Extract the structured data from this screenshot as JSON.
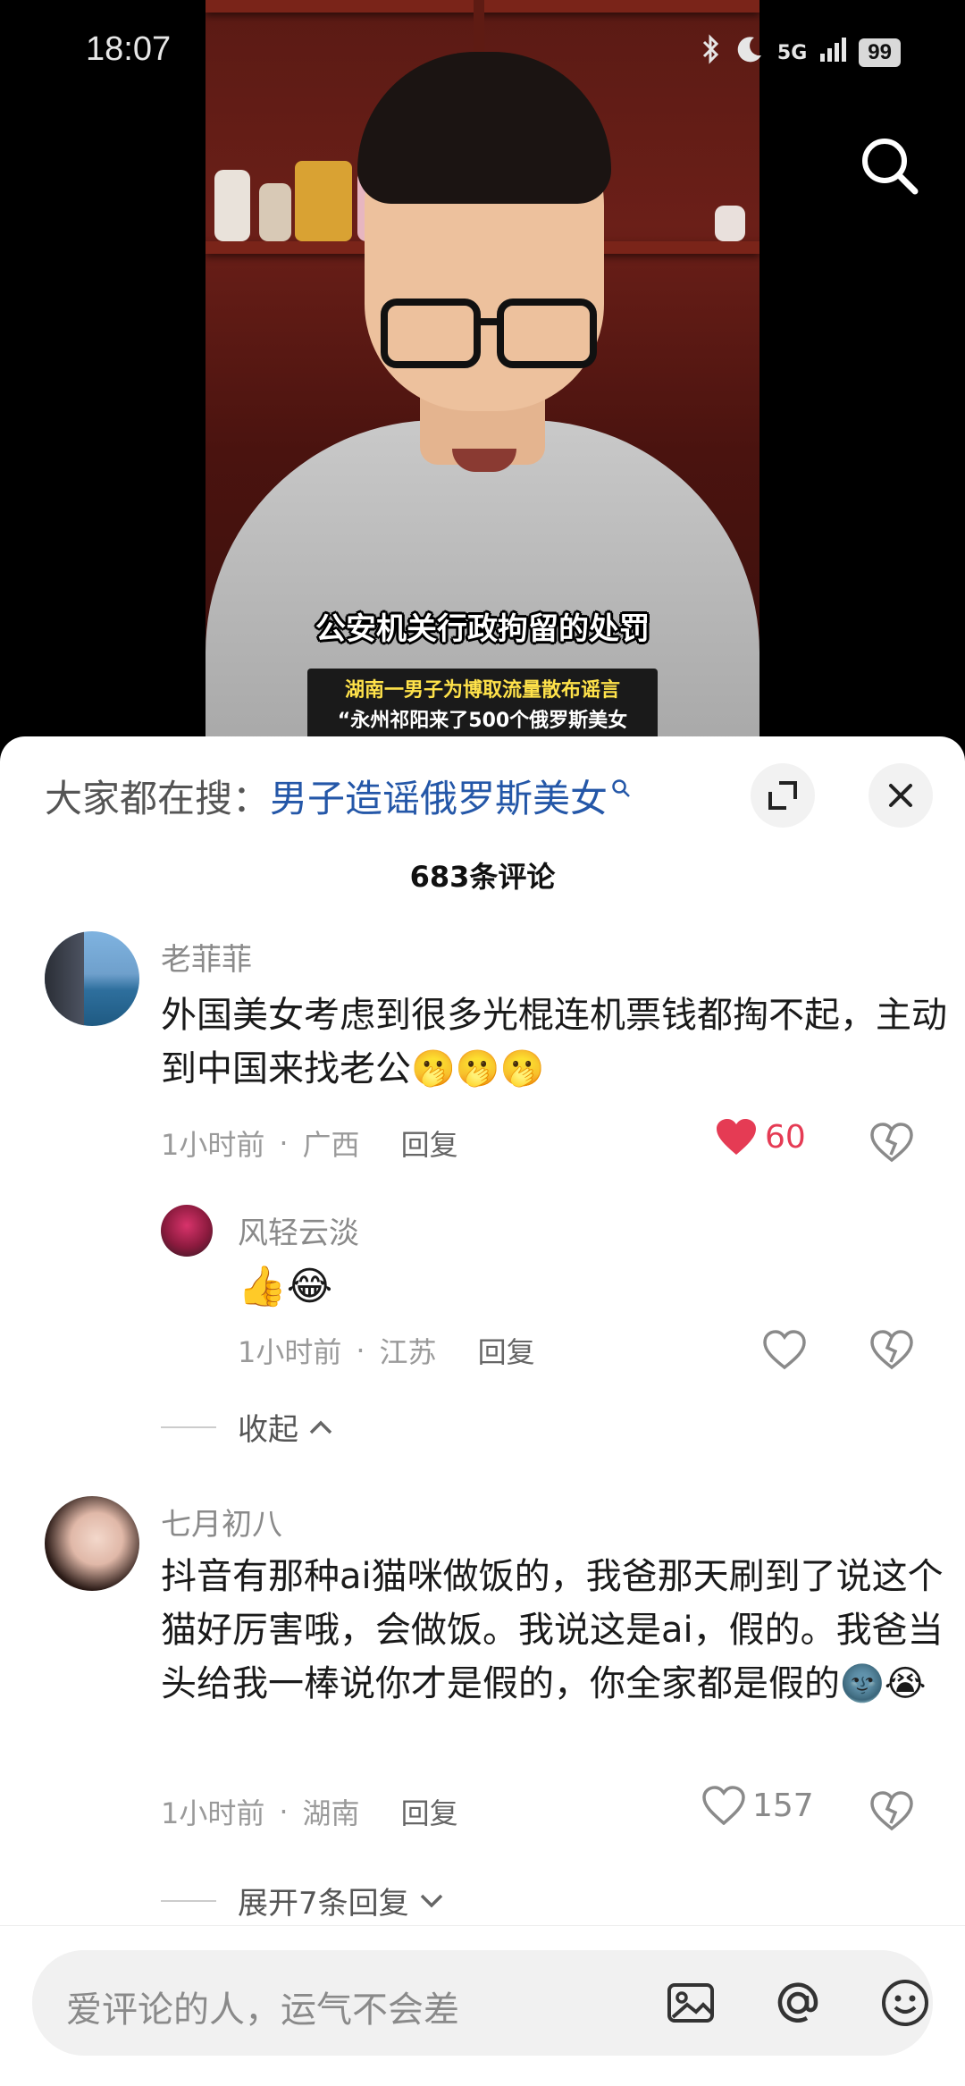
{
  "status_bar": {
    "time": "18:07",
    "signal": "5G",
    "battery": "99"
  },
  "video": {
    "subtitle": "公安机关行政拘留的处罚",
    "news_line1": "湖南一男子为博取流量散布谣言",
    "news_line2": "“永州祁阳来了500个俄罗斯美女"
  },
  "search_bar": {
    "label": "大家都在搜：",
    "term": "男子造谣俄罗斯美女"
  },
  "comments_header": {
    "count_label": "683条评论"
  },
  "comments": [
    {
      "username": "老菲菲",
      "text": "外国美女考虑到很多光棍连机票钱都掏不起，主动到中国来找老公🫢🫢🫢",
      "time": "1小时前",
      "location": "广西",
      "reply_label": "回复",
      "likes": "60",
      "liked": true,
      "replies": [
        {
          "username": "风轻云淡",
          "text": "👍😂",
          "time": "1小时前",
          "location": "江苏",
          "reply_label": "回复"
        }
      ],
      "toggle_label": "收起"
    },
    {
      "username": "七月初八",
      "text": "抖音有那种ai猫咪做饭的，我爸那天刷到了说这个猫好厉害哦，会做饭。我说这是ai，假的。我爸当头给我一棒说你才是假的，你全家都是假的🌚😭",
      "time": "1小时前",
      "location": "湖南",
      "reply_label": "回复",
      "likes": "157",
      "liked": false,
      "toggle_label": "展开7条回复"
    }
  ],
  "input": {
    "placeholder": "爱评论的人，运气不会差"
  },
  "colors": {
    "accent_blue": "#2457a8",
    "like_red": "#e53b54"
  }
}
